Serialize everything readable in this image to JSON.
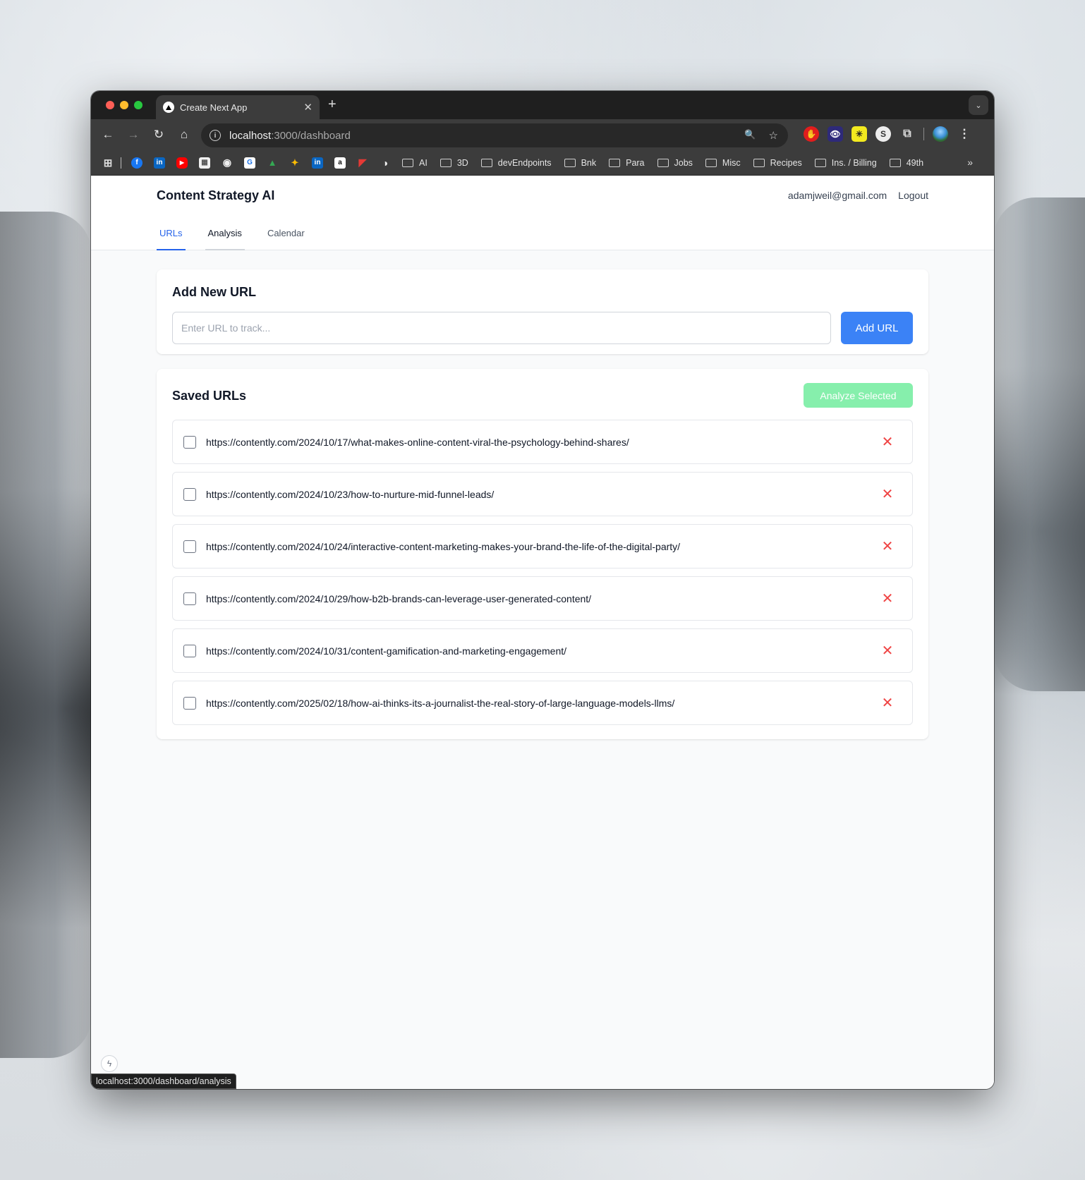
{
  "browser": {
    "tab_title": "Create Next App",
    "tab_close": "✕",
    "new_tab": "+",
    "tab_menu": "⌄",
    "nav": {
      "back": "←",
      "forward": "→",
      "reload": "↻",
      "home": "⌂"
    },
    "omnibox_info": "i",
    "address_host": "localhost",
    "address_path": ":3000/dashboard",
    "omni_icons": {
      "zoom": "🔍",
      "star": "☆"
    },
    "extensions": [
      "✋",
      "👁",
      "✳",
      "S",
      "⧉"
    ],
    "menu": "⋮",
    "bookmark_icons": [
      "⊞",
      "f",
      "in",
      "▶",
      "▦",
      "◉",
      "G",
      "▲",
      "✦",
      "in",
      "a",
      "◤",
      "◑"
    ],
    "bookmark_folders": [
      "AI",
      "3D",
      "devEndpoints",
      "Bnk",
      "Para",
      "Jobs",
      "Misc",
      "Recipes",
      "Ins. / Billing",
      "49th"
    ],
    "bookmarks_more": "»",
    "status_url": "localhost:3000/dashboard/analysis"
  },
  "app": {
    "brand": "Content Strategy AI",
    "user_email": "adamjweil@gmail.com",
    "logout": "Logout",
    "tabs": [
      {
        "label": "URLs",
        "active": true
      },
      {
        "label": "Analysis",
        "active": false
      },
      {
        "label": "Calendar",
        "active": false
      }
    ]
  },
  "add_url": {
    "title": "Add New URL",
    "placeholder": "Enter URL to track...",
    "button": "Add URL"
  },
  "saved_urls": {
    "title": "Saved URLs",
    "analyze_button": "Analyze Selected",
    "delete_glyph": "✕",
    "items": [
      "https://contently.com/2024/10/17/what-makes-online-content-viral-the-psychology-behind-shares/",
      "https://contently.com/2024/10/23/how-to-nurture-mid-funnel-leads/",
      "https://contently.com/2024/10/24/interactive-content-marketing-makes-your-brand-the-life-of-the-digital-party/",
      "https://contently.com/2024/10/29/how-b2b-brands-can-leverage-user-generated-content/",
      "https://contently.com/2024/10/31/content-gamification-and-marketing-engagement/",
      "https://contently.com/2025/02/18/how-ai-thinks-its-a-journalist-the-real-story-of-large-language-models-llms/"
    ]
  },
  "dev_indicator": "ϟ",
  "colors": {
    "primary": "#3b82f6",
    "analyze_disabled": "#86efac",
    "delete": "#ef4444",
    "active_tab": "#2563eb"
  }
}
